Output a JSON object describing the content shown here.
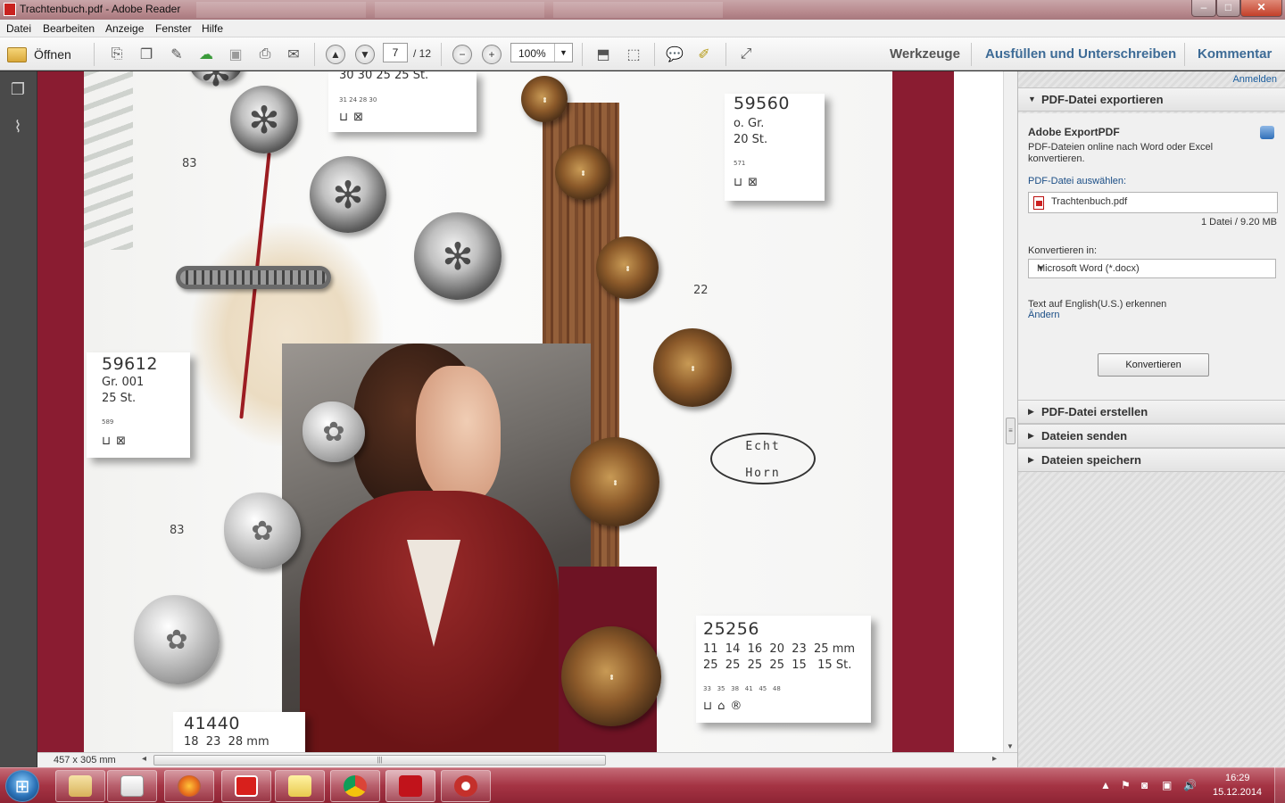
{
  "window": {
    "title": "Trachtenbuch.pdf - Adobe Reader",
    "minimize": "–",
    "maximize": "□",
    "close": "✕"
  },
  "menu": [
    "Datei",
    "Bearbeiten",
    "Anzeige",
    "Fenster",
    "Hilfe"
  ],
  "toolbar": {
    "open_label": "Öffnen",
    "page_current": "7",
    "page_total": "/ 12",
    "zoom": "100%",
    "tabs": {
      "tools": "Werkzeuge",
      "fill_sign": "Ausfüllen und Unterschreiben",
      "comment": "Kommentar"
    },
    "icons": [
      "create-pdf-icon",
      "combine-icon",
      "edit-icon",
      "upload-icon",
      "save-icon",
      "print-icon",
      "email-icon",
      "page-up-icon",
      "page-down-icon",
      "zoom-out-icon",
      "zoom-in-icon",
      "fit-page-icon",
      "fit-width-icon",
      "comment-icon",
      "highlight-icon",
      "expand-icon"
    ]
  },
  "document": {
    "page_size": "457 x 305 mm",
    "cards": {
      "c59560": {
        "num": "59560",
        "l1": "o. Gr.",
        "l2": "20 St.",
        "tiny": "571"
      },
      "c59612": {
        "num": "59612",
        "l1": "Gr. 001",
        "l2": "25 St.",
        "tiny": "589"
      },
      "c25256": {
        "num": "25256",
        "l1": "11  14  16  20  23  25 mm",
        "l2": "25  25  25  25  15   15 St.",
        "tiny": "33   35   38   41   45   48"
      },
      "c41440": {
        "num": "41440",
        "l1": "18  23  28 mm"
      },
      "ctop": {
        "l1": "30  30  25  25 St.",
        "tiny": "31     24     28     30"
      }
    },
    "labels": {
      "p83a": "83",
      "p83b": "83",
      "p22": "22"
    },
    "stamp": {
      "line1": "Echt",
      "line2": "Horn"
    }
  },
  "taskpane": {
    "signin": "Anmelden",
    "export_header": "PDF-Datei exportieren",
    "service_title": "Adobe ExportPDF",
    "service_desc": "PDF-Dateien online nach Word oder Excel konvertieren.",
    "select_label": "PDF-Datei auswählen:",
    "file_name": "Trachtenbuch.pdf",
    "file_count": "1 Datei / 9.20 MB",
    "convert_to_label": "Konvertieren in:",
    "format": "Microsoft Word (*.docx)",
    "ocr_text": "Text auf English(U.S.) erkennen",
    "change_link": "Ändern",
    "convert_button": "Konvertieren",
    "sections": [
      "PDF-Datei erstellen",
      "Dateien senden",
      "Dateien speichern"
    ]
  },
  "taskbar": {
    "apps": [
      "file-explorer",
      "media-player",
      "firefox",
      "foxit-reader",
      "sticky-notes",
      "chrome",
      "adobe-reader",
      "acrobat"
    ],
    "time": "16:29",
    "date": "15.12.2014"
  }
}
